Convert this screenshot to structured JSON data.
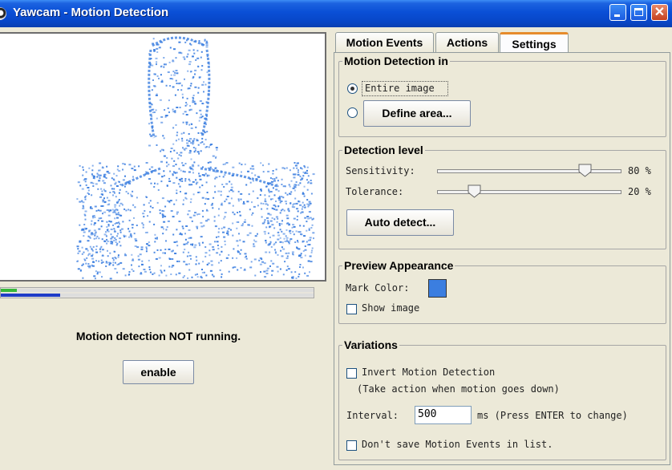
{
  "window": {
    "title": "Yawcam - Motion Detection",
    "close_glyph": "✕"
  },
  "status": {
    "text": "Motion detection NOT running.",
    "enable_label": "enable"
  },
  "progress": {
    "motion_fraction": 0.05,
    "level_fraction": 0.19,
    "colors": {
      "motion": "#37b83a",
      "level": "#1f3cc8"
    }
  },
  "tabs": [
    {
      "label": "Motion Events"
    },
    {
      "label": "Actions"
    },
    {
      "label": "Settings",
      "selected": true
    }
  ],
  "motion_detection_in": {
    "title": "Motion Detection in",
    "entire_image_label": "Entire image",
    "define_area_label": "Define area...",
    "selected": "Entire image"
  },
  "detection_level": {
    "title": "Detection level",
    "sensitivity_label": "Sensitivity:",
    "sensitivity_value": "80 %",
    "sensitivity_fraction": 0.8,
    "tolerance_label": "Tolerance:",
    "tolerance_value": "20 %",
    "tolerance_fraction": 0.2,
    "auto_detect_label": "Auto detect..."
  },
  "preview_appearance": {
    "title": "Preview Appearance",
    "mark_color_label": "Mark Color:",
    "mark_color": "#3b7ee0",
    "show_image_label": "Show image",
    "show_image_checked": false
  },
  "variations": {
    "title": "Variations",
    "invert_label": "Invert Motion Detection",
    "invert_checked": false,
    "invert_note": "(Take action when motion goes down)",
    "interval_label": "Interval:",
    "interval_value": "500",
    "interval_unit_note": "ms (Press ENTER to change)",
    "dont_save_label": "Don't save Motion Events in list.",
    "dont_save_checked": false
  },
  "icons": {
    "app": "webcam-icon",
    "minimize": "minimize-icon",
    "maximize": "maximize-icon",
    "close": "close-icon",
    "thumb": "slider-thumb-icon"
  }
}
